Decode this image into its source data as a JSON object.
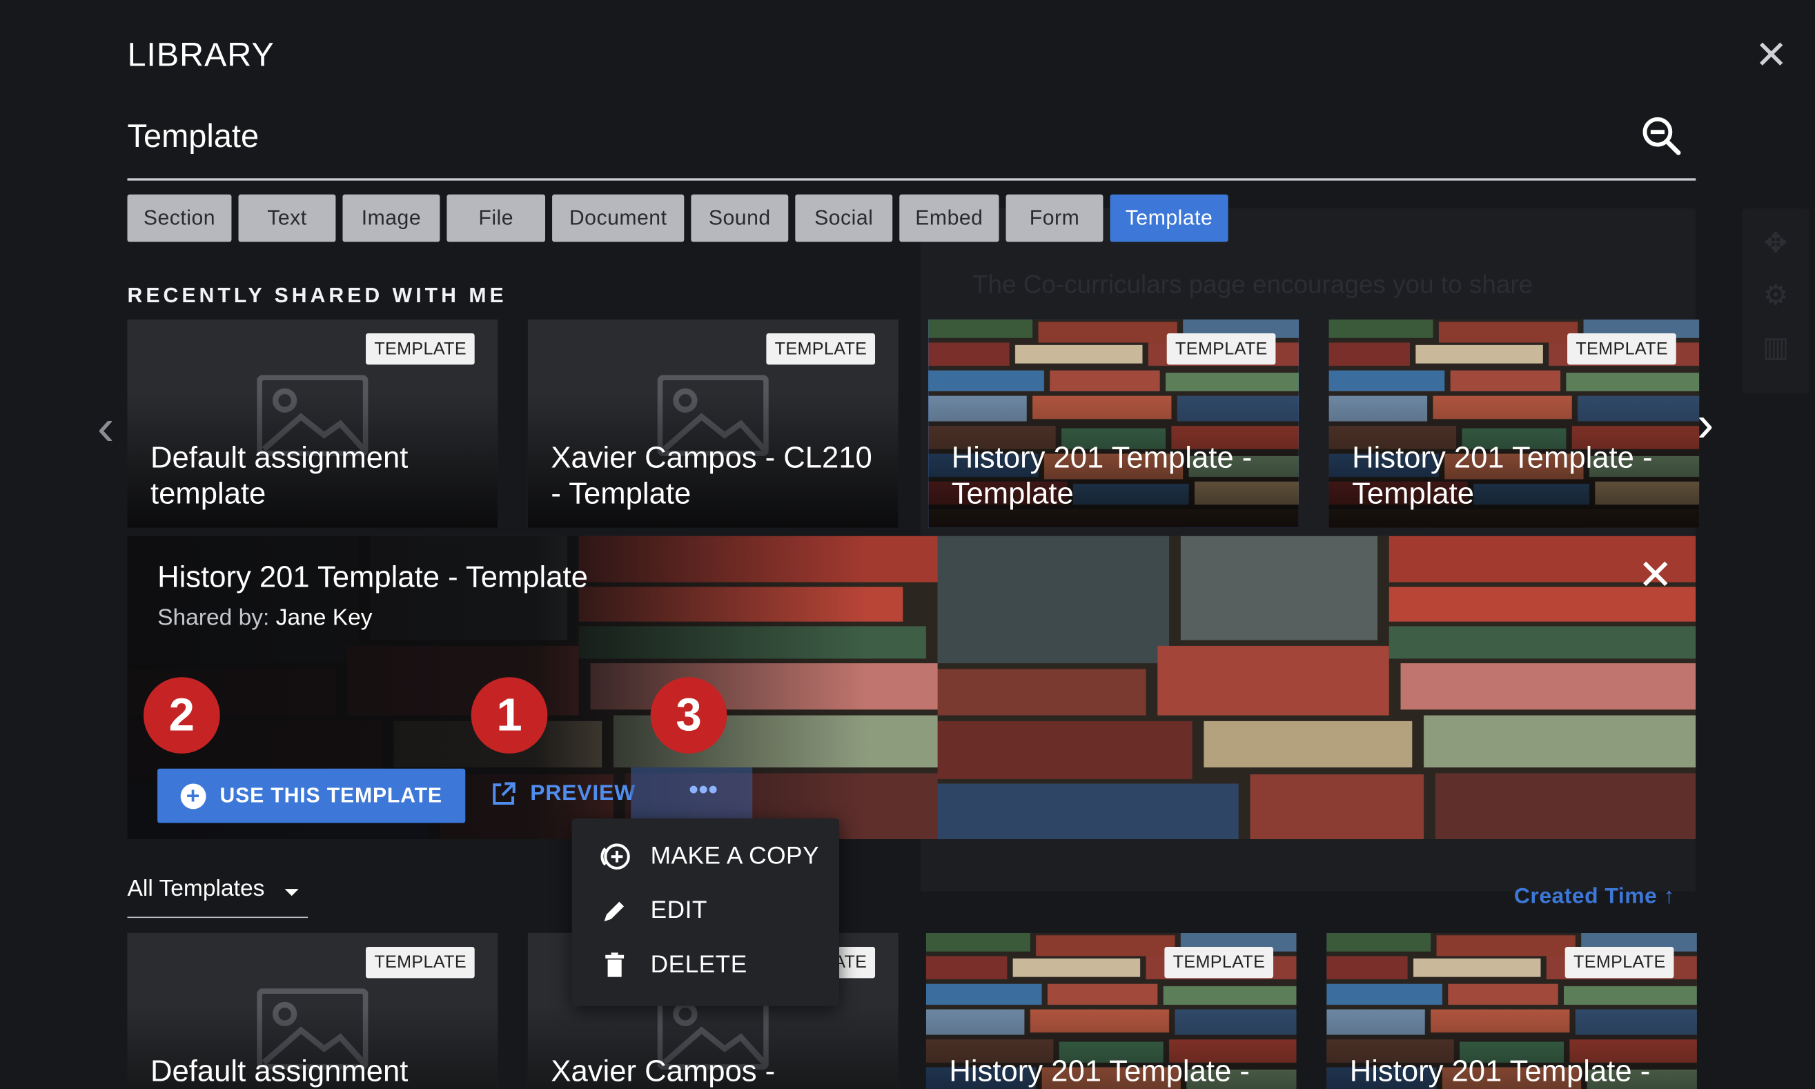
{
  "library": {
    "title": "LIBRARY",
    "close_icon": "close-icon",
    "search": {
      "value": "Template",
      "icon": "zoom-out-search-icon"
    },
    "filters": [
      "Section",
      "Text",
      "Image",
      "File",
      "Document",
      "Sound",
      "Social",
      "Embed",
      "Form",
      "Template"
    ],
    "active_filter": "Template",
    "background_text": "The Co-curriculars page encourages you to share"
  },
  "recent": {
    "label": "RECENTLY SHARED WITH ME",
    "cards": [
      {
        "badge": "TEMPLATE",
        "title": "Default assignment template"
      },
      {
        "badge": "TEMPLATE",
        "title": "Xavier Campos - CL210 - Template"
      },
      {
        "badge": "TEMPLATE",
        "title": "History 201 Template - Template"
      },
      {
        "badge": "TEMPLATE",
        "title": "History 201 Template - Template"
      }
    ]
  },
  "detail": {
    "title": "History 201 Template - Template",
    "shared_by_label": "Shared by:",
    "shared_by_name": "Jane Key",
    "use_button": "USE THIS TEMPLATE",
    "preview_button": "PREVIEW",
    "more_button": "•••",
    "markers": [
      "2",
      "1",
      "3"
    ]
  },
  "menu": {
    "items": [
      {
        "label": "MAKE A COPY",
        "icon": "copy-add-icon"
      },
      {
        "label": "EDIT",
        "icon": "pencil-icon"
      },
      {
        "label": "DELETE",
        "icon": "trash-icon"
      }
    ]
  },
  "all": {
    "dropdown": "All Templates",
    "sort": "Created Time",
    "cards": [
      {
        "badge": "TEMPLATE",
        "title": "Default assignment"
      },
      {
        "badge": "TEMPLATE",
        "title": "Xavier Campos -"
      },
      {
        "badge": "TEMPLATE",
        "title": "History 201 Template -"
      },
      {
        "badge": "TEMPLATE",
        "title": "History 201 Template -"
      }
    ]
  },
  "colors": {
    "accent": "#3d78d8",
    "marker": "#c62424",
    "chip": "#b6b8bd"
  }
}
